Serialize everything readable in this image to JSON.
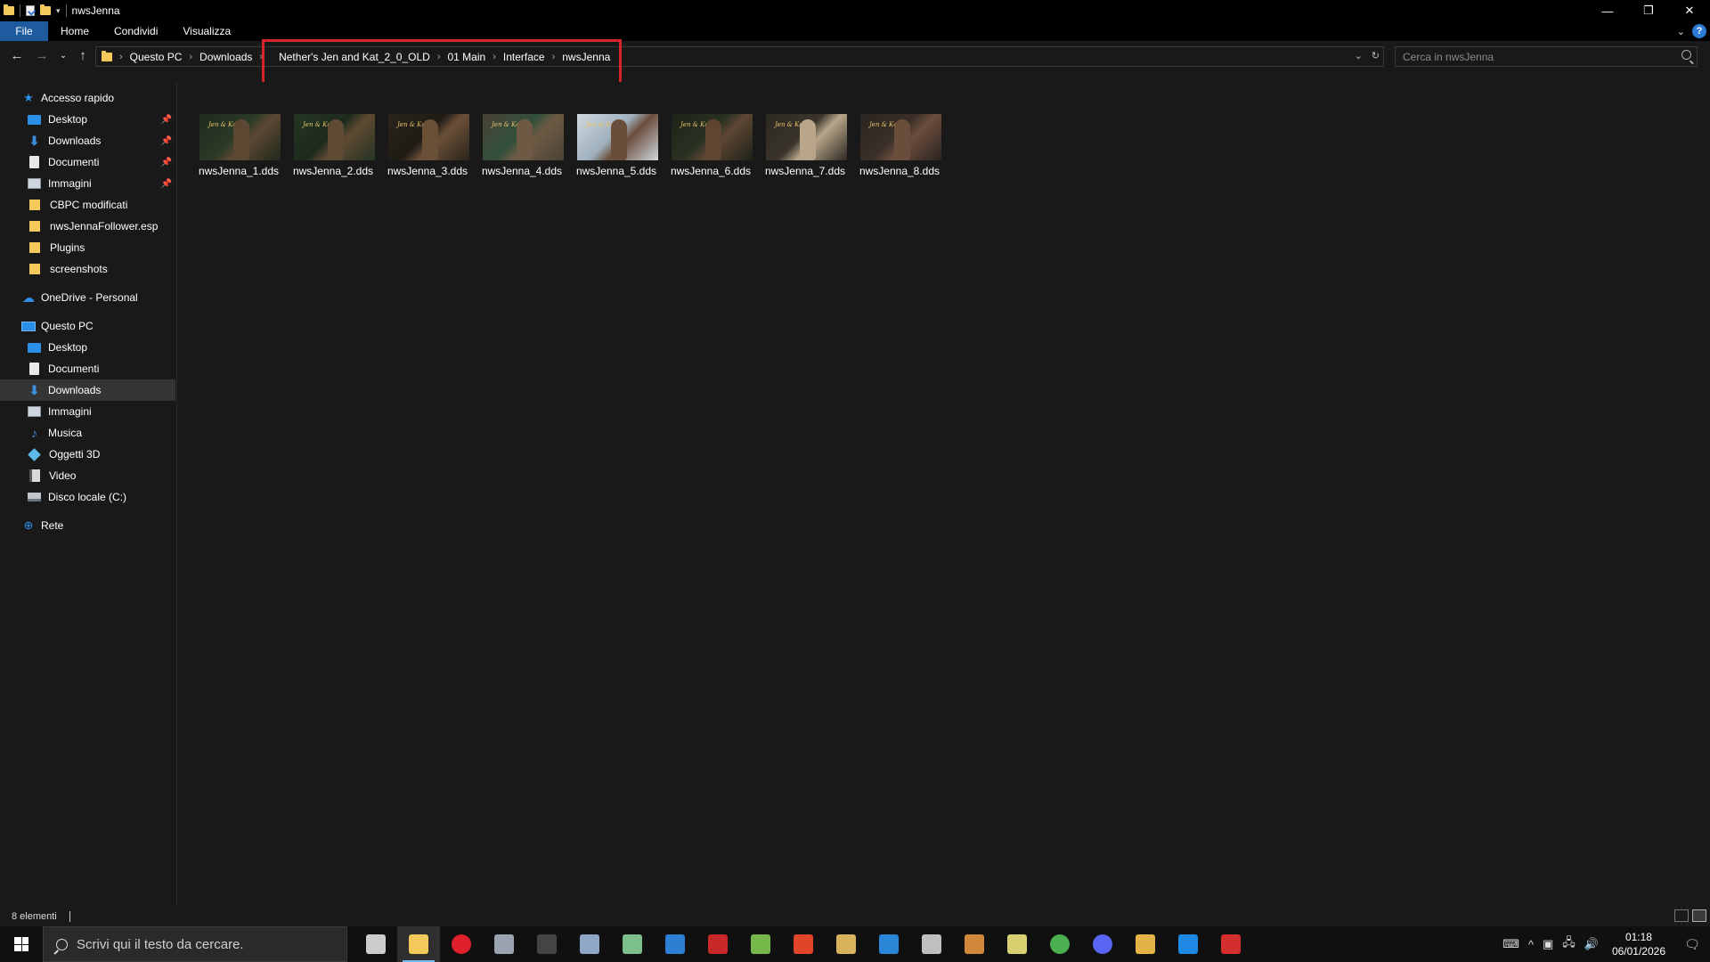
{
  "window": {
    "title": "nwsJenna",
    "controls": {
      "minimize": "—",
      "maximize": "❐",
      "close": "✕"
    }
  },
  "ribbon": {
    "tabs": [
      "File",
      "Home",
      "Condividi",
      "Visualizza"
    ],
    "help": "?"
  },
  "address": {
    "crumbs": [
      "Questo PC",
      "Downloads",
      "Nether's Jen and Kat_2_0_OLD",
      "01 Main",
      "Interface",
      "nwsJenna"
    ],
    "highlight_color": "#d7242b"
  },
  "search": {
    "placeholder": "Cerca in nwsJenna"
  },
  "sidebar": {
    "quick_access": {
      "label": "Accesso rapido",
      "items": [
        {
          "label": "Desktop",
          "icon": "desktop-icon",
          "pinned": true
        },
        {
          "label": "Downloads",
          "icon": "downloads-icon",
          "pinned": true
        },
        {
          "label": "Documenti",
          "icon": "documents-icon",
          "pinned": true
        },
        {
          "label": "Immagini",
          "icon": "pictures-icon",
          "pinned": true
        },
        {
          "label": "CBPC modificati",
          "icon": "folder-icon",
          "pinned": false
        },
        {
          "label": "nwsJennaFollower.esp",
          "icon": "folder-icon",
          "pinned": false
        },
        {
          "label": "Plugins",
          "icon": "folder-icon",
          "pinned": false
        },
        {
          "label": "screenshots",
          "icon": "folder-icon",
          "pinned": false
        }
      ]
    },
    "onedrive": {
      "label": "OneDrive - Personal"
    },
    "this_pc": {
      "label": "Questo PC",
      "items": [
        {
          "label": "Desktop",
          "icon": "desktop-icon"
        },
        {
          "label": "Documenti",
          "icon": "documents-icon"
        },
        {
          "label": "Downloads",
          "icon": "downloads-icon",
          "selected": true
        },
        {
          "label": "Immagini",
          "icon": "pictures-icon"
        },
        {
          "label": "Musica",
          "icon": "music-icon"
        },
        {
          "label": "Oggetti 3D",
          "icon": "3d-objects-icon"
        },
        {
          "label": "Video",
          "icon": "video-icon"
        },
        {
          "label": "Disco locale (C:)",
          "icon": "disk-icon"
        }
      ]
    },
    "network": {
      "label": "Rete"
    }
  },
  "files": [
    {
      "name": "nwsJenna_1.dds",
      "colors": [
        "#1f2a1c",
        "#5c4732",
        "#2b3a27"
      ]
    },
    {
      "name": "nwsJenna_2.dds",
      "colors": [
        "#253524",
        "#5f4a33",
        "#1c2a1d"
      ]
    },
    {
      "name": "nwsJenna_3.dds",
      "colors": [
        "#2a241c",
        "#6b5038",
        "#1e1b15"
      ]
    },
    {
      "name": "nwsJenna_4.dds",
      "colors": [
        "#4a4236",
        "#6e5a44",
        "#31503b"
      ]
    },
    {
      "name": "nwsJenna_5.dds",
      "colors": [
        "#cfd8df",
        "#6a4d3a",
        "#9fb0bd"
      ]
    },
    {
      "name": "nwsJenna_6.dds",
      "colors": [
        "#1d2218",
        "#5e4633",
        "#2b3222"
      ]
    },
    {
      "name": "nwsJenna_7.dds",
      "colors": [
        "#2c2822",
        "#b9a68a",
        "#3a342c"
      ]
    },
    {
      "name": "nwsJenna_8.dds",
      "colors": [
        "#2a2420",
        "#6b4d3c",
        "#3b3029"
      ]
    }
  ],
  "status": {
    "count": "8 elementi"
  },
  "taskbar": {
    "search_placeholder": "Scrivi qui il testo da cercare.",
    "apps": [
      {
        "name": "task-view",
        "color": "#cccccc"
      },
      {
        "name": "file-explorer",
        "color": "#f3c95b",
        "active": true
      },
      {
        "name": "opera",
        "color": "#e0202a"
      },
      {
        "name": "app-3",
        "color": "#9aa4b0"
      },
      {
        "name": "app-4",
        "color": "#444444"
      },
      {
        "name": "app-5",
        "color": "#8fa6c8"
      },
      {
        "name": "app-6",
        "color": "#7cbf8c"
      },
      {
        "name": "app-7",
        "color": "#2d7fd4"
      },
      {
        "name": "app-8",
        "color": "#c82828"
      },
      {
        "name": "app-9",
        "color": "#76b84a"
      },
      {
        "name": "app-10",
        "color": "#e0452a"
      },
      {
        "name": "app-11",
        "color": "#d9b35c"
      },
      {
        "name": "app-12",
        "color": "#2a86d6"
      },
      {
        "name": "app-13",
        "color": "#bfbfbf"
      },
      {
        "name": "app-14",
        "color": "#d2883a"
      },
      {
        "name": "app-15",
        "color": "#d8d070"
      },
      {
        "name": "chrome",
        "color": "#4caf50"
      },
      {
        "name": "discord",
        "color": "#5865f2"
      },
      {
        "name": "app-18",
        "color": "#e3b347"
      },
      {
        "name": "app-19",
        "color": "#1e88e5"
      },
      {
        "name": "app-20",
        "color": "#d32f2f"
      }
    ],
    "time": "01:18",
    "date": "06/01/2026"
  }
}
